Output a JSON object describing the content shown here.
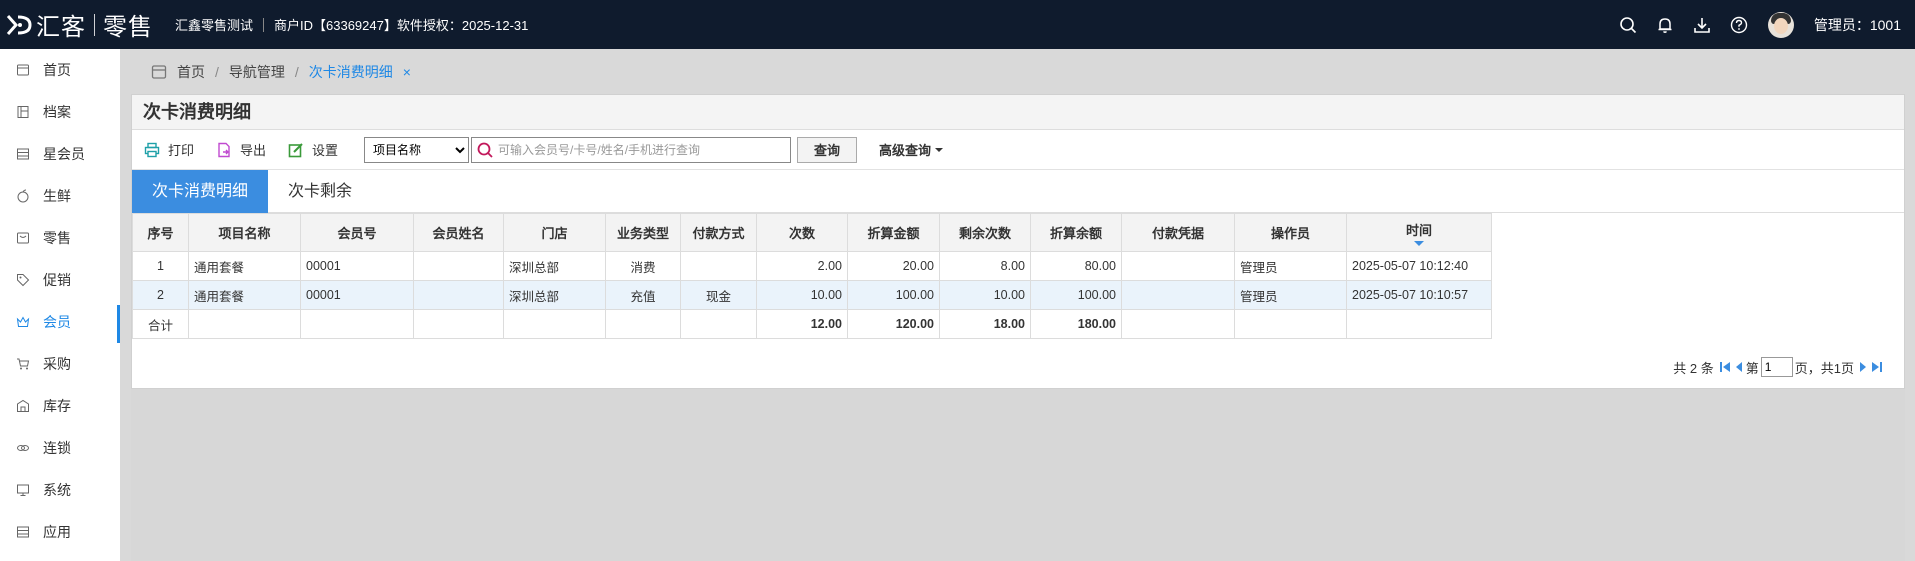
{
  "header": {
    "logo_text": "汇客",
    "logo_sub": "零售",
    "shop_name": "汇鑫零售测试",
    "merchant_info": "商户ID【63369247】软件授权：2025-12-31",
    "admin_label": "管理员：1001",
    "icons": [
      "search-icon",
      "bell-icon",
      "download-icon",
      "help-icon"
    ]
  },
  "sidebar": {
    "items": [
      {
        "label": "首页",
        "icon": "home-icon"
      },
      {
        "label": "档案",
        "icon": "archive-icon"
      },
      {
        "label": "星会员",
        "icon": "star-member-icon"
      },
      {
        "label": "生鲜",
        "icon": "apple-icon"
      },
      {
        "label": "零售",
        "icon": "retail-icon"
      },
      {
        "label": "促销",
        "icon": "tag-icon"
      },
      {
        "label": "会员",
        "icon": "crown-icon"
      },
      {
        "label": "采购",
        "icon": "cart-icon"
      },
      {
        "label": "库存",
        "icon": "warehouse-icon"
      },
      {
        "label": "连锁",
        "icon": "chain-icon"
      },
      {
        "label": "系统",
        "icon": "monitor-icon"
      },
      {
        "label": "应用",
        "icon": "apps-icon"
      }
    ],
    "active_index": 6
  },
  "breadcrumb": {
    "home": "首页",
    "level2": "导航管理",
    "current": "次卡消费明细",
    "close": "×"
  },
  "panel": {
    "title": "次卡消费明细"
  },
  "toolbar": {
    "print": "打印",
    "export": "导出",
    "settings": "设置",
    "select_value": "项目名称",
    "search_placeholder": "可输入会员号/卡号/姓名/手机进行查询",
    "query": "查询",
    "advanced": "高级查询"
  },
  "tabs": [
    "次卡消费明细",
    "次卡剩余"
  ],
  "table": {
    "columns": [
      "序号",
      "项目名称",
      "会员号",
      "会员姓名",
      "门店",
      "业务类型",
      "付款方式",
      "次数",
      "折算金额",
      "剩余次数",
      "折算余额",
      "付款凭据",
      "操作员",
      "时间"
    ],
    "rows": [
      [
        "1",
        "通用套餐",
        "00001",
        "",
        "深圳总部",
        "消费",
        "",
        "2.00",
        "20.00",
        "8.00",
        "80.00",
        "",
        "管理员",
        "2025-05-07 10:12:40"
      ],
      [
        "2",
        "通用套餐",
        "00001",
        "",
        "深圳总部",
        "充值",
        "现金",
        "10.00",
        "100.00",
        "10.00",
        "100.00",
        "",
        "管理员",
        "2025-05-07 10:10:57"
      ]
    ],
    "total": {
      "label": "合计",
      "count": "12.00",
      "amount": "120.00",
      "remaining": "18.00",
      "balance": "180.00"
    }
  },
  "pager": {
    "total_text": "共 2 条",
    "page_prefix": "第",
    "page_value": "1",
    "page_suffix": "页，共1页"
  },
  "colors": {
    "topbar": "#0f1b2d",
    "accent": "#1e88e5",
    "tab_active": "#3b8de0",
    "row_alt": "#eaf3fb"
  }
}
